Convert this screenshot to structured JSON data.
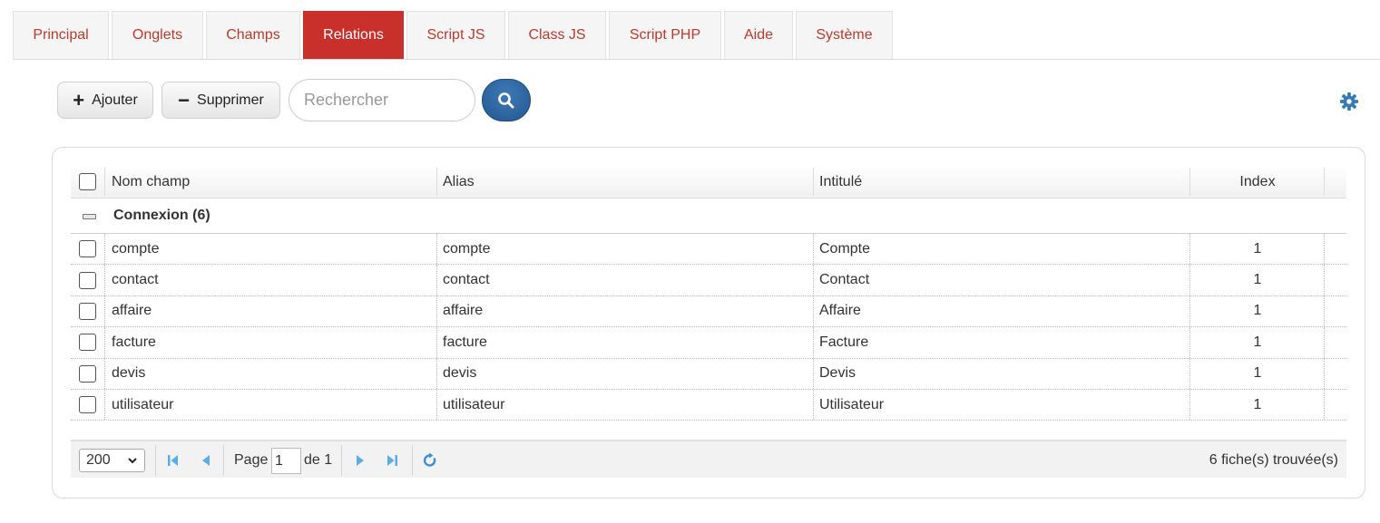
{
  "tabs": [
    {
      "label": "Principal"
    },
    {
      "label": "Onglets"
    },
    {
      "label": "Champs"
    },
    {
      "label": "Relations",
      "active": true
    },
    {
      "label": "Script JS"
    },
    {
      "label": "Class JS"
    },
    {
      "label": "Script PHP"
    },
    {
      "label": "Aide"
    },
    {
      "label": "Système"
    }
  ],
  "toolbar": {
    "add_label": "Ajouter",
    "delete_label": "Supprimer",
    "search_placeholder": "Rechercher",
    "search_value": ""
  },
  "grid": {
    "columns": [
      "Nom champ",
      "Alias",
      "Intitulé",
      "Index"
    ],
    "group": {
      "label": "Connexion (6)"
    },
    "rows": [
      {
        "nom": "compte",
        "alias": "compte",
        "intitule": "Compte",
        "index": "1"
      },
      {
        "nom": "contact",
        "alias": "contact",
        "intitule": "Contact",
        "index": "1"
      },
      {
        "nom": "affaire",
        "alias": "affaire",
        "intitule": "Affaire",
        "index": "1"
      },
      {
        "nom": "facture",
        "alias": "facture",
        "intitule": "Facture",
        "index": "1"
      },
      {
        "nom": "devis",
        "alias": "devis",
        "intitule": "Devis",
        "index": "1"
      },
      {
        "nom": "utilisateur",
        "alias": "utilisateur",
        "intitule": "Utilisateur",
        "index": "1"
      }
    ]
  },
  "pager": {
    "page_size": "200",
    "page_label": "Page",
    "page_value": "1",
    "of_label": "de 1",
    "records": "6 fiche(s) trouvée(s)"
  },
  "colors": {
    "accent": "#c9302c",
    "tab_text": "#c0392b",
    "search_button": "#2a5f97",
    "icon_blue": "#337ab7",
    "nav_icon": "#5aaee8"
  },
  "icons": [
    "plus-icon",
    "minus-icon",
    "search-icon",
    "gear-icon",
    "collapse-icon",
    "first-page-icon",
    "prev-page-icon",
    "next-page-icon",
    "last-page-icon",
    "refresh-icon",
    "chevron-down-icon"
  ]
}
